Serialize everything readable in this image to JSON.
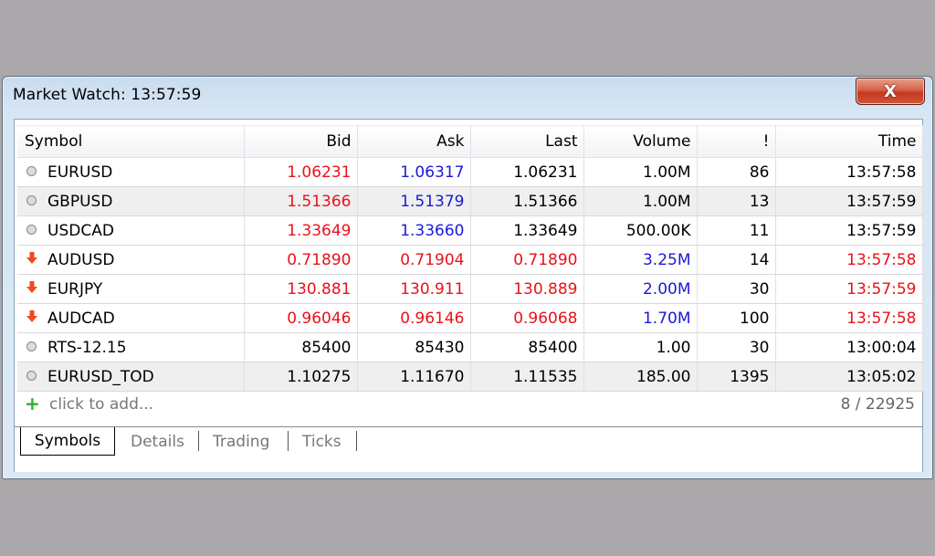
{
  "window": {
    "title": "Market Watch: 13:57:59",
    "close_label": "X"
  },
  "columns": [
    "Symbol",
    "Bid",
    "Ask",
    "Last",
    "Volume",
    "!",
    "Time"
  ],
  "rows": [
    {
      "symbol": "EURUSD",
      "bid": "1.06231",
      "ask": "1.06317",
      "last": "1.06231",
      "volume": "1.00M",
      "count": "86",
      "time": "13:57:58"
    },
    {
      "symbol": "GBPUSD",
      "bid": "1.51366",
      "ask": "1.51379",
      "last": "1.51366",
      "volume": "1.00M",
      "count": "13",
      "time": "13:57:59"
    },
    {
      "symbol": "USDCAD",
      "bid": "1.33649",
      "ask": "1.33660",
      "last": "1.33649",
      "volume": "500.00K",
      "count": "11",
      "time": "13:57:59"
    },
    {
      "symbol": "AUDUSD",
      "bid": "0.71890",
      "ask": "0.71904",
      "last": "0.71890",
      "volume": "3.25M",
      "count": "14",
      "time": "13:57:58"
    },
    {
      "symbol": "EURJPY",
      "bid": "130.881",
      "ask": "130.911",
      "last": "130.889",
      "volume": "2.00M",
      "count": "30",
      "time": "13:57:59"
    },
    {
      "symbol": "AUDCAD",
      "bid": "0.96046",
      "ask": "0.96146",
      "last": "0.96068",
      "volume": "1.70M",
      "count": "100",
      "time": "13:57:58"
    },
    {
      "symbol": "RTS-12.15",
      "bid": "85400",
      "ask": "85430",
      "last": "85400",
      "volume": "1.00",
      "count": "30",
      "time": "13:00:04"
    },
    {
      "symbol": "EURUSD_TOD",
      "bid": "1.10275",
      "ask": "1.11670",
      "last": "1.11535",
      "volume": "185.00",
      "count": "1395",
      "time": "13:05:02"
    }
  ],
  "add_row": {
    "label": "click to add...",
    "count": "8 / 22925"
  },
  "tabs": [
    "Symbols",
    "Details",
    "Trading",
    "Ticks"
  ],
  "colors": {
    "down": "#e8121a",
    "up": "#1a1ad8",
    "add": "#2fae2b"
  }
}
